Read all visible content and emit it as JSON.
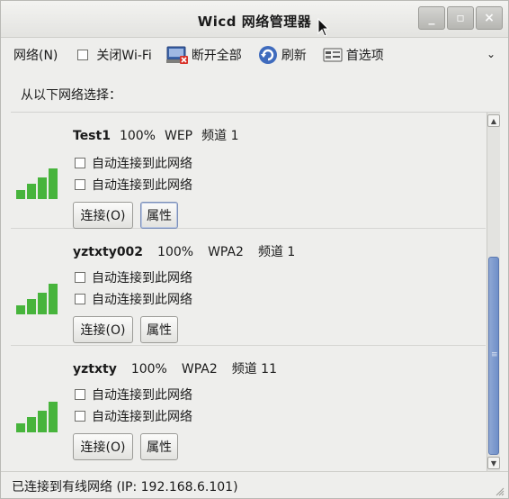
{
  "window": {
    "title": "Wicd 网络管理器",
    "controls": {
      "minimize": "_",
      "maximize": "▫",
      "close": "×"
    }
  },
  "toolbar": {
    "network_menu": "网络(N)",
    "disable_wifi": "关闭Wi-Fi",
    "disconnect_all": "断开全部",
    "refresh": "刷新",
    "preferences": "首选项",
    "overflow": "⌄"
  },
  "prompt": "从以下网络选择：",
  "networks": [
    {
      "ssid": "Test1",
      "strength": "100%",
      "encryption": "WEP",
      "channel": "频道 1",
      "checkbox1": "自动连接到此网络",
      "checkbox2": "自动连接到此网络",
      "connect": "连接(O)",
      "properties": "属性"
    },
    {
      "ssid": "yztxty002",
      "strength": "100%",
      "encryption": "WPA2",
      "channel": "频道 1",
      "checkbox1": "自动连接到此网络",
      "checkbox2": "自动连接到此网络",
      "connect": "连接(O)",
      "properties": "属性"
    },
    {
      "ssid": "yztxty",
      "strength": "100%",
      "encryption": "WPA2",
      "channel": "频道 11",
      "checkbox1": "自动连接到此网络",
      "checkbox2": "自动连接到此网络",
      "connect": "连接(O)",
      "properties": "属性"
    }
  ],
  "status": "已连接到有线网络 (IP: 192.168.6.101)",
  "colors": {
    "signal_green": "#47b43c",
    "scroll_thumb": "#7f9bce"
  },
  "icons": {
    "disconnect": "computer-disconnect-icon",
    "refresh": "refresh-icon",
    "preferences": "preferences-icon",
    "signal": "signal-strength-icon"
  }
}
